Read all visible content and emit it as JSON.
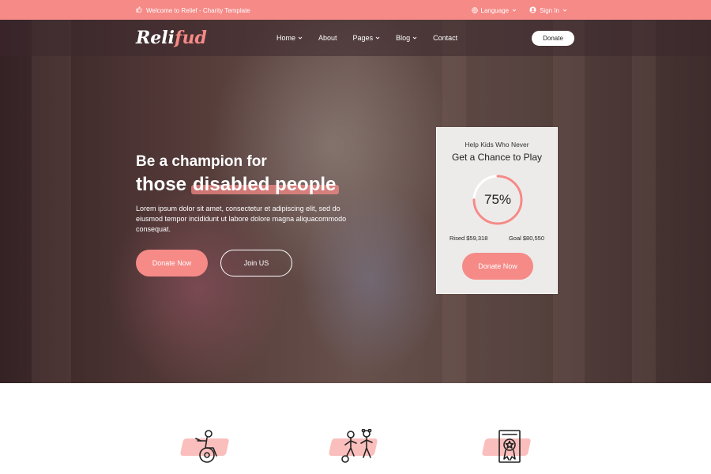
{
  "topbar": {
    "welcome": "Welcome to Relief - Charity Template",
    "language": "Language",
    "signin": "Sign In"
  },
  "nav": {
    "logo_main": "Reli",
    "logo_accent": "fud",
    "menu": [
      {
        "label": "Home"
      },
      {
        "label": "About"
      },
      {
        "label": "Pages"
      },
      {
        "label": "Blog"
      },
      {
        "label": "Contact"
      }
    ],
    "donate": "Donate"
  },
  "hero": {
    "line1": "Be a champion for",
    "line2a": "those",
    "line2b": "disabled people",
    "description": "Lorem ipsum dolor sit amet, consectetur et adipiscing elit, sed do eiusmod tempor incididunt ut labore dolore magna aliquacommodo consequat.",
    "donate_btn": "Donate Now",
    "join_btn": "Join US"
  },
  "card": {
    "title_small": "Help Kids Who Never",
    "title_big": "Get a Chance to Play",
    "percent_label": "75%",
    "progress": 0.75,
    "raised": "Rised $59,318",
    "goal": "Goal $80,550",
    "button": "Donate Now"
  },
  "colors": {
    "accent": "#f58a87"
  },
  "features": [
    {
      "icon": "wheelchair-icon"
    },
    {
      "icon": "kids-playing-icon"
    },
    {
      "icon": "certificate-award-icon"
    }
  ]
}
